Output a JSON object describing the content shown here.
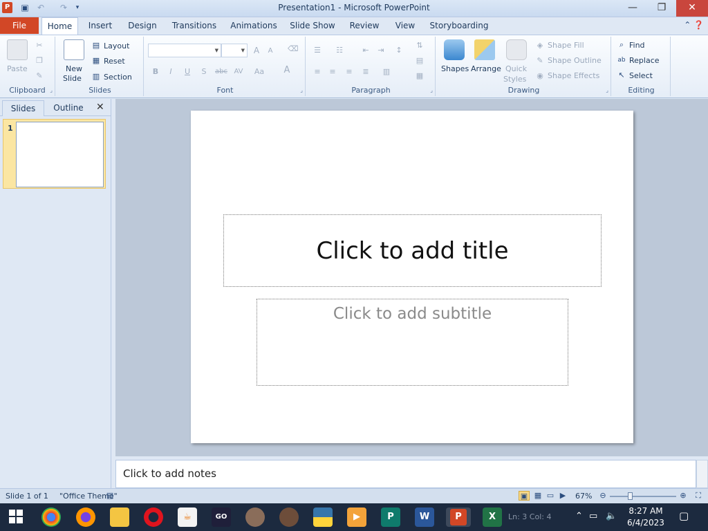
{
  "window": {
    "title": "Presentation1 - Microsoft PowerPoint",
    "app_letter": "P"
  },
  "tabs": {
    "file": "File",
    "items": [
      "Home",
      "Insert",
      "Design",
      "Transitions",
      "Animations",
      "Slide Show",
      "Review",
      "View",
      "Storyboarding"
    ]
  },
  "ribbon": {
    "clipboard": {
      "label": "Clipboard",
      "paste": "Paste"
    },
    "slides": {
      "label": "Slides",
      "new_slide_1": "New",
      "new_slide_2": "Slide",
      "layout": "Layout",
      "reset": "Reset",
      "section": "Section"
    },
    "font": {
      "label": "Font",
      "bold": "B",
      "italic": "I",
      "underline": "U",
      "shadow": "S",
      "strike": "abc",
      "spacing": "AV",
      "case": "Aa",
      "grow": "A",
      "shrink": "A",
      "color": "A"
    },
    "paragraph": {
      "label": "Paragraph"
    },
    "drawing": {
      "label": "Drawing",
      "shapes": "Shapes",
      "arrange": "Arrange",
      "quick_1": "Quick",
      "quick_2": "Styles",
      "shape_fill": "Shape Fill",
      "shape_outline": "Shape Outline",
      "shape_effects": "Shape Effects"
    },
    "editing": {
      "label": "Editing",
      "find": "Find",
      "replace": "Replace",
      "select": "Select"
    }
  },
  "left_pane": {
    "tab_slides": "Slides",
    "tab_outline": "Outline",
    "close": "✕",
    "slide_number": "1"
  },
  "slide": {
    "title_placeholder": "Click to add title",
    "subtitle_placeholder": "Click to add subtitle"
  },
  "notes": {
    "placeholder": "Click to add notes"
  },
  "status": {
    "slide_info": "Slide 1 of 1",
    "theme": "\"Office Theme\"",
    "zoom": "67%"
  },
  "taskbar": {
    "time": "8:27 AM",
    "date": "6/4/2023",
    "ghost": "Ln: 3  Col: 4"
  },
  "colors": {
    "file_tab": "#d24726",
    "close_button": "#c9463d",
    "thumb_highlight": "#fbe6a2",
    "taskbar": "#1c2a3f"
  }
}
